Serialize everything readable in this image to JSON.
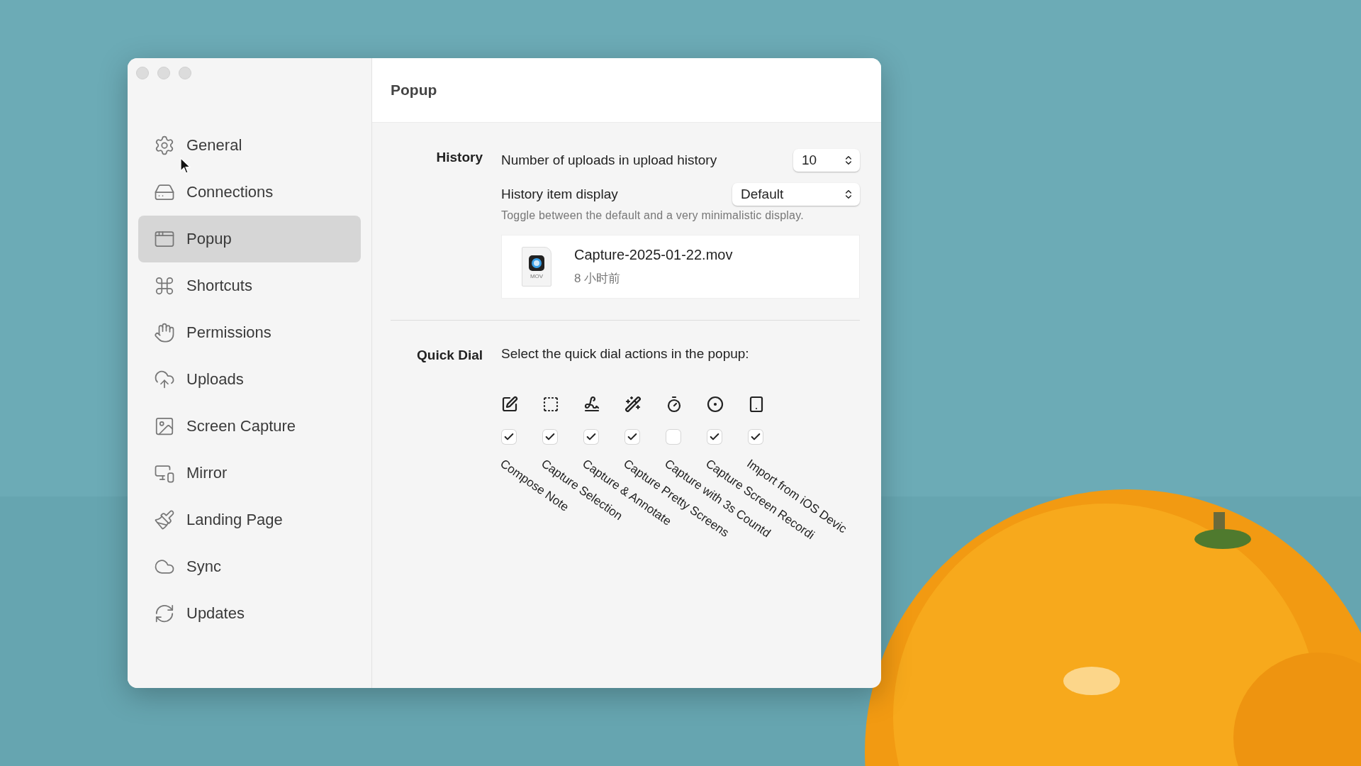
{
  "window": {
    "title": "Popup"
  },
  "sidebar": {
    "items": [
      {
        "label": "General",
        "selected": false
      },
      {
        "label": "Connections",
        "selected": false
      },
      {
        "label": "Popup",
        "selected": true
      },
      {
        "label": "Shortcuts",
        "selected": false
      },
      {
        "label": "Permissions",
        "selected": false
      },
      {
        "label": "Uploads",
        "selected": false
      },
      {
        "label": "Screen Capture",
        "selected": false
      },
      {
        "label": "Mirror",
        "selected": false
      },
      {
        "label": "Landing Page",
        "selected": false
      },
      {
        "label": "Sync",
        "selected": false
      },
      {
        "label": "Updates",
        "selected": false
      }
    ]
  },
  "history": {
    "label": "History",
    "upload_count": {
      "label": "Number of uploads in upload history",
      "value": "10"
    },
    "item_display": {
      "label": "History item display",
      "value": "Default",
      "hint": "Toggle between the default and a very minimalistic display."
    },
    "preview": {
      "file_badge": "MOV",
      "name": "Capture-2025-01-22.mov",
      "time": "8 小时前"
    }
  },
  "quick_dial": {
    "label": "Quick Dial",
    "prompt": "Select the quick dial actions in the popup:",
    "actions": [
      {
        "label": "Compose Note",
        "checked": true
      },
      {
        "label": "Capture Selection",
        "checked": true
      },
      {
        "label": "Capture & Annotate",
        "checked": true
      },
      {
        "label": "Capture Pretty Screens",
        "checked": true
      },
      {
        "label": "Capture with 3s Countd",
        "checked": false
      },
      {
        "label": "Capture Screen Recordi",
        "checked": true
      },
      {
        "label": "Import from iOS Devic",
        "checked": true
      }
    ]
  }
}
